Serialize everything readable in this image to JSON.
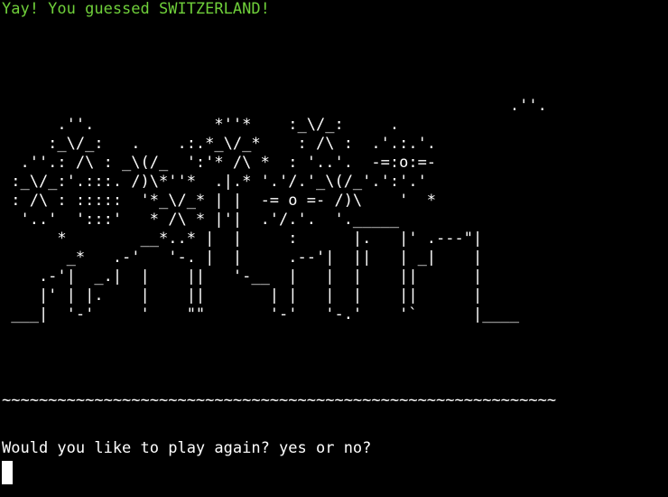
{
  "terminal": {
    "success_message": "Yay! You guessed SWITZERLAND!",
    "ascii_art": "                                                       .''.\n      .''.             *''*    :_\\/_:     .\n     :_\\/_:   .    .:.*_\\/_*    : /\\ :  .'.:.'.\n  .''.: /\\ : _\\(/_  ':'* /\\ *  : '..'.  -=:o:=-\n :_\\/_:'.:::. /)\\*''*  .|.* '.'/.'_\\(/_'.':'.'\n : /\\ : :::::  '*_\\/_* | |  -= o =- /)\\    '  *\n  '..'  ':::'   * /\\ * |'|  .'/.'.  '._____\n      *        __*..* |  |     :      |.   |' .---\"|\n       _*   .-'   '-. |  |     .--'|  ||   | _|    |\n    .-'|  _.|  |    ||   '-__  |   |  |    ||      |\n    |' | |.    |    ||       | |   |  |    ||      |\n ___|  '-'     '    \"\"       '-'   '-.'    '`      |____",
    "ground": "~~~~~~~~~~~~~~~~~~~~~~~~~~~~~~~~~~~~~~~~~~~~~~~~~~~~~~~~~~~~",
    "prompt": "Would you like to play again? yes or no?",
    "input_value": ""
  }
}
